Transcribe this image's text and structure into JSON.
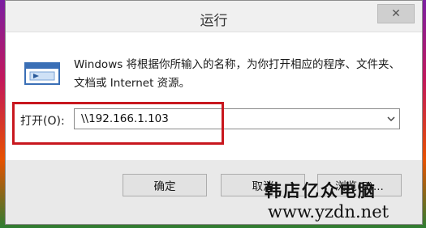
{
  "dialog": {
    "title": "运行",
    "close_symbol": "✕",
    "description": "Windows 将根据你所输入的名称，为你打开相应的程序、文件夹、文档或 Internet 资源。",
    "open_label": "打开(O):",
    "open_value": "\\\\192.166.1.103"
  },
  "buttons": {
    "ok": "确定",
    "cancel": "取消",
    "browse": "浏览(B)..."
  },
  "watermark": {
    "text": "韩店亿众电脑",
    "url": "www.yzdn.net"
  },
  "colors": {
    "highlight": "#c8171e"
  },
  "icons": [
    "run-icon",
    "close-icon",
    "chevron-down-icon"
  ]
}
